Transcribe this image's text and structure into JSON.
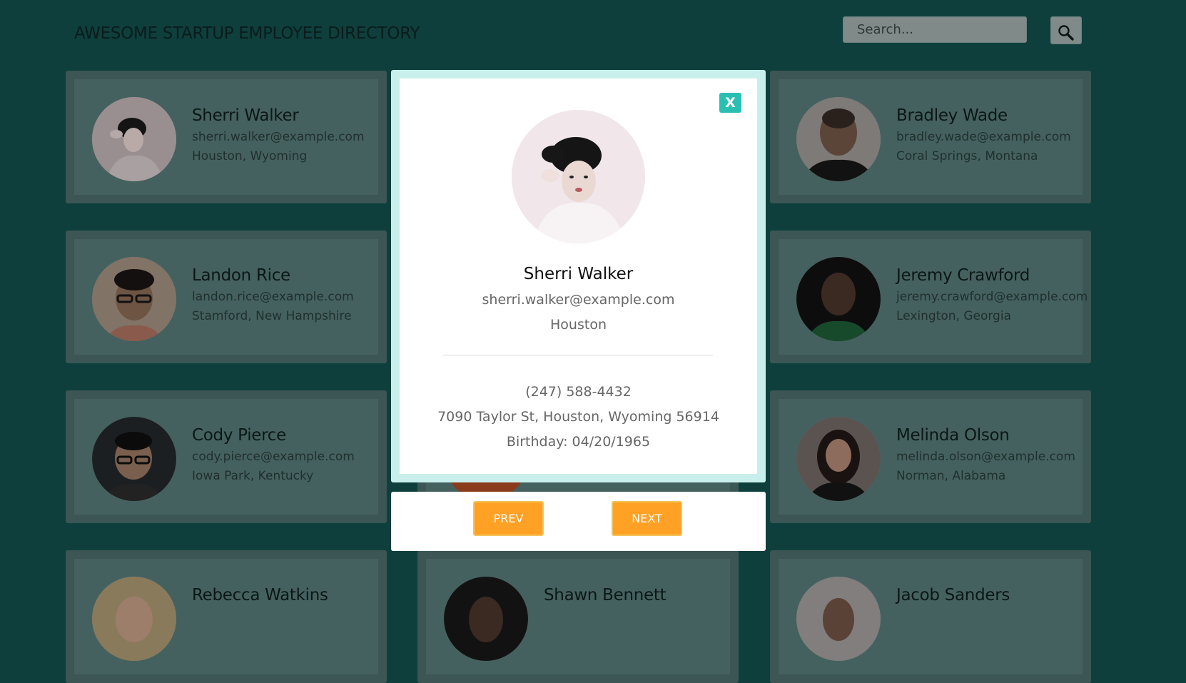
{
  "header": {
    "title": "AWESOME STARTUP EMPLOYEE DIRECTORY",
    "search_placeholder": "Search...",
    "search_icon": "magnifier-icon"
  },
  "employees": [
    {
      "name": "Sherri Walker",
      "email": "sherri.walker@example.com",
      "location": "Houston, Wyoming"
    },
    {
      "name": "Bradley Wade",
      "email": "bradley.wade@example.com",
      "location": "Coral Springs, Montana"
    },
    {
      "name": "Landon Rice",
      "email": "landon.rice@example.com",
      "location": "Stamford, New Hampshire"
    },
    {
      "name": "Jeremy Crawford",
      "email": "jeremy.crawford@example.com",
      "location": "Lexington, Georgia"
    },
    {
      "name": "Cody Pierce",
      "email": "cody.pierce@example.com",
      "location": "Iowa Park, Kentucky"
    },
    {
      "name": "Melinda Olson",
      "email": "melinda.olson@example.com",
      "location": "Norman, Alabama"
    },
    {
      "name": "Rebecca Watkins",
      "email": "",
      "location": ""
    },
    {
      "name": "Shawn Bennett",
      "email": "",
      "location": ""
    },
    {
      "name": "Jacob Sanders",
      "email": "",
      "location": ""
    }
  ],
  "modal": {
    "close_label": "X",
    "name": "Sherri Walker",
    "email": "sherri.walker@example.com",
    "city": "Houston",
    "phone": "(247) 588-4432",
    "address": "7090 Taylor St, Houston, Wyoming 56914",
    "birthday": "Birthday: 04/20/1965"
  },
  "navigation": {
    "prev_label": "PREV",
    "next_label": "NEXT"
  },
  "colors": {
    "background": "#0e3f3d",
    "close_button": "#2abfb3",
    "nav_button": "#ffa124",
    "modal_border": "#c8efec"
  }
}
